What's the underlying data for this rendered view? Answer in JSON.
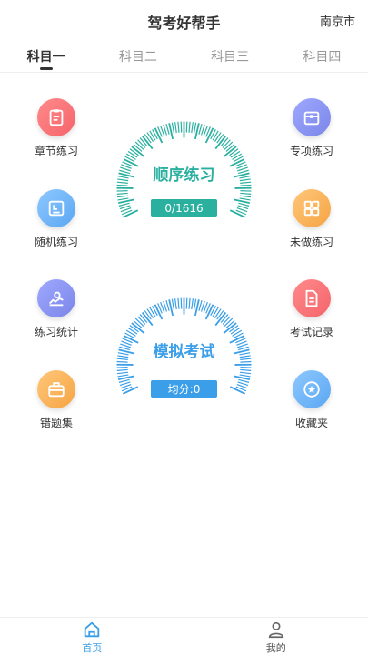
{
  "header": {
    "title": "驾考好帮手",
    "city": "南京市"
  },
  "tabs": [
    {
      "label": "科目一",
      "active": true
    },
    {
      "label": "科目二",
      "active": false
    },
    {
      "label": "科目三",
      "active": false
    },
    {
      "label": "科目四",
      "active": false
    }
  ],
  "features": {
    "chapter": {
      "label": "章节练习",
      "icon": "clipboard-icon"
    },
    "special": {
      "label": "专项练习",
      "icon": "box-icon"
    },
    "random": {
      "label": "随机练习",
      "icon": "random-icon"
    },
    "undone": {
      "label": "未做练习",
      "icon": "grid-icon"
    },
    "stats": {
      "label": "练习统计",
      "icon": "stats-icon"
    },
    "exam_record": {
      "label": "考试记录",
      "icon": "document-icon"
    },
    "wrong": {
      "label": "错题集",
      "icon": "toolbox-icon"
    },
    "favorites": {
      "label": "收藏夹",
      "icon": "star-icon"
    }
  },
  "sequence_gauge": {
    "title": "顺序练习",
    "progress": "0/1616",
    "color": "#2bb0a0"
  },
  "mock_gauge": {
    "title": "模拟考试",
    "score": "均分:0",
    "color": "#3a9ee8"
  },
  "bottom_nav": [
    {
      "label": "首页",
      "icon": "home-icon",
      "active": true
    },
    {
      "label": "我的",
      "icon": "person-icon",
      "active": false
    }
  ]
}
